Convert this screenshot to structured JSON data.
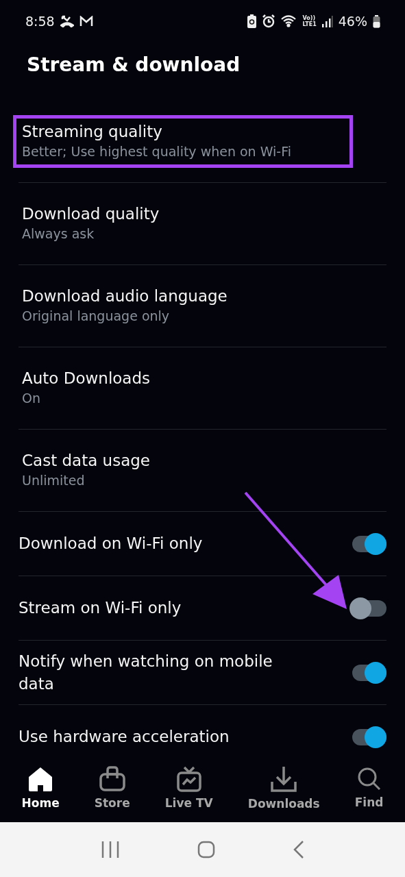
{
  "status_bar": {
    "time": "8:58",
    "network_top": "Vo))",
    "network_bottom": "LTE1",
    "battery": "46%"
  },
  "title": "Stream & download",
  "settings": [
    {
      "kind": "detail",
      "title": "Streaming quality",
      "value": "Better; Use highest quality when on Wi-Fi",
      "highlighted": true
    },
    {
      "kind": "detail",
      "title": "Download quality",
      "value": "Always ask",
      "highlighted": false
    },
    {
      "kind": "detail",
      "title": "Download audio language",
      "value": "Original language only",
      "highlighted": false
    },
    {
      "kind": "detail",
      "title": "Auto Downloads",
      "value": "On",
      "highlighted": false
    },
    {
      "kind": "detail",
      "title": "Cast data usage",
      "value": "Unlimited",
      "highlighted": false
    },
    {
      "kind": "toggle",
      "title": "Download on Wi-Fi only",
      "on": true,
      "pointed": false
    },
    {
      "kind": "toggle",
      "title": "Stream on Wi-Fi only",
      "on": false,
      "pointed": true
    },
    {
      "kind": "toggle",
      "title": "Notify when watching on mobile data",
      "on": true,
      "pointed": false
    },
    {
      "kind": "toggle",
      "title": "Use hardware acceleration",
      "on": true,
      "pointed": false
    }
  ],
  "nav": [
    {
      "label": "Home",
      "selected": true
    },
    {
      "label": "Store",
      "selected": false
    },
    {
      "label": "Live TV",
      "selected": false
    },
    {
      "label": "Downloads",
      "selected": false
    },
    {
      "label": "Find",
      "selected": false
    }
  ]
}
